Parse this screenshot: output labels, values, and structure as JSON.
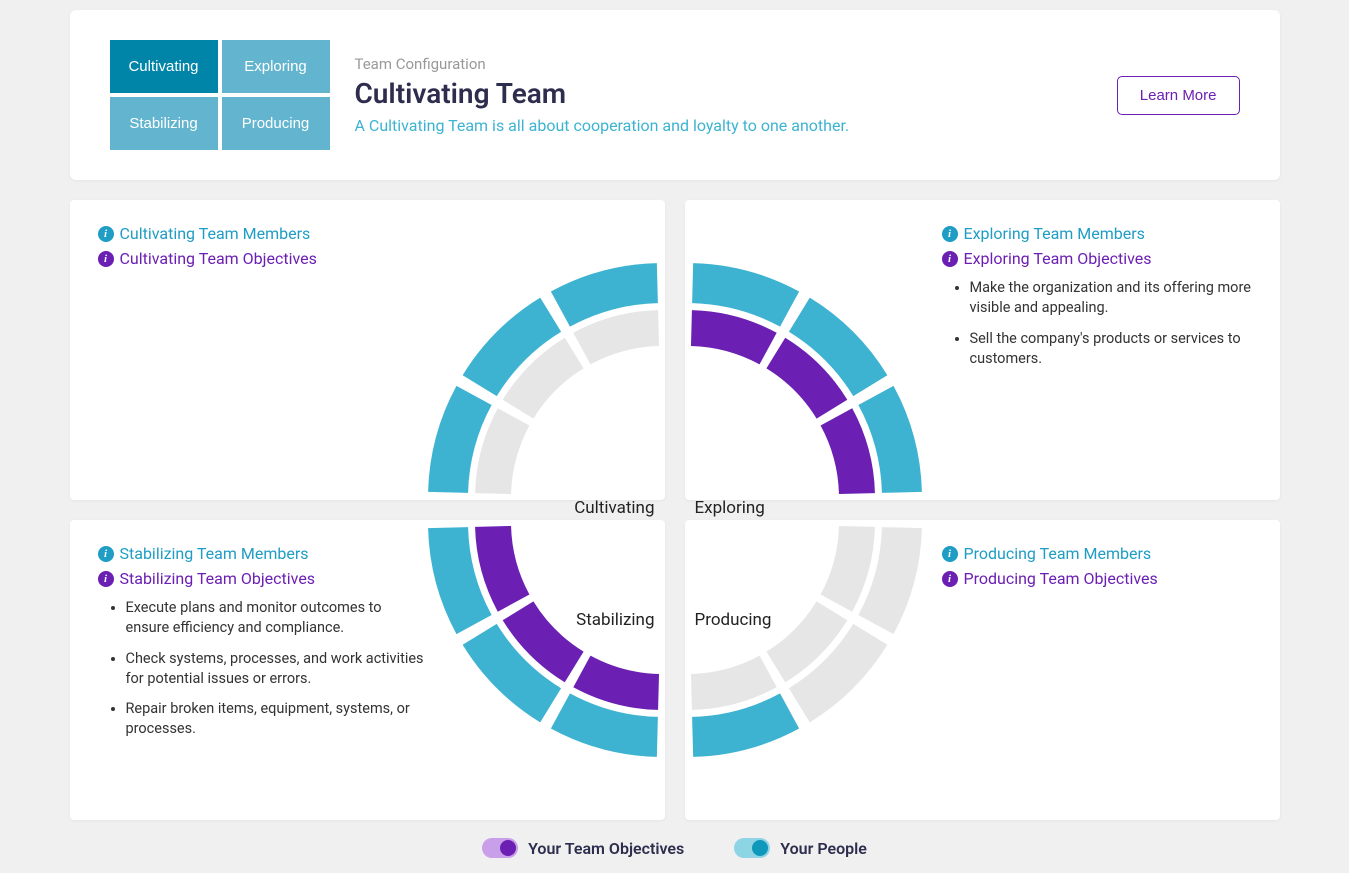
{
  "header": {
    "subtitle": "Team Configuration",
    "title": "Cultivating Team",
    "description": "A Cultivating Team is all about cooperation and loyalty to one another.",
    "learn_more": "Learn More",
    "buttons": {
      "cultivating": "Cultivating",
      "exploring": "Exploring",
      "stabilizing": "Stabilizing",
      "producing": "Producing"
    }
  },
  "quadrants": {
    "cultivating": {
      "members_label": "Cultivating Team Members",
      "objectives_label": "Cultivating Team Objectives",
      "chart_label": "Cultivating",
      "objectives": []
    },
    "exploring": {
      "members_label": "Exploring Team Members",
      "objectives_label": "Exploring Team Objectives",
      "chart_label": "Exploring",
      "objectives": [
        "Make the organization and its offering more visible and appealing.",
        "Sell the company's products or services to customers."
      ]
    },
    "stabilizing": {
      "members_label": "Stabilizing Team Members",
      "objectives_label": "Stabilizing Team Objectives",
      "chart_label": "Stabilizing",
      "objectives": [
        "Execute plans and monitor outcomes to ensure efficiency and compliance.",
        "Check systems, processes, and work activities for potential issues or errors.",
        "Repair broken items, equipment, systems, or processes."
      ]
    },
    "producing": {
      "members_label": "Producing Team Members",
      "objectives_label": "Producing Team Objectives",
      "chart_label": "Producing",
      "objectives": []
    }
  },
  "legend": {
    "objectives": "Your Team Objectives",
    "people": "Your People"
  },
  "colors": {
    "teal": "#3db3d1",
    "purple": "#6b1fb3",
    "teal_dark": "#0084a8",
    "teal_light": "#63b5cf",
    "gray_arc": "#e6e6e6"
  },
  "chart_data": {
    "type": "pie",
    "title": "Team Quadrant Distribution",
    "rings": [
      {
        "name": "Your People",
        "color": "#3db3d1",
        "quadrants": {
          "cultivating": {
            "segments": 3,
            "filled": 3
          },
          "exploring": {
            "segments": 3,
            "filled": 3
          },
          "stabilizing": {
            "segments": 3,
            "filled": 3
          },
          "producing": {
            "segments": 3,
            "filled": 1
          }
        }
      },
      {
        "name": "Your Team Objectives",
        "color": "#6b1fb3",
        "quadrants": {
          "cultivating": {
            "segments": 3,
            "filled": 0
          },
          "exploring": {
            "segments": 3,
            "filled": 3
          },
          "stabilizing": {
            "segments": 3,
            "filled": 3
          },
          "producing": {
            "segments": 3,
            "filled": 0
          }
        }
      }
    ]
  }
}
